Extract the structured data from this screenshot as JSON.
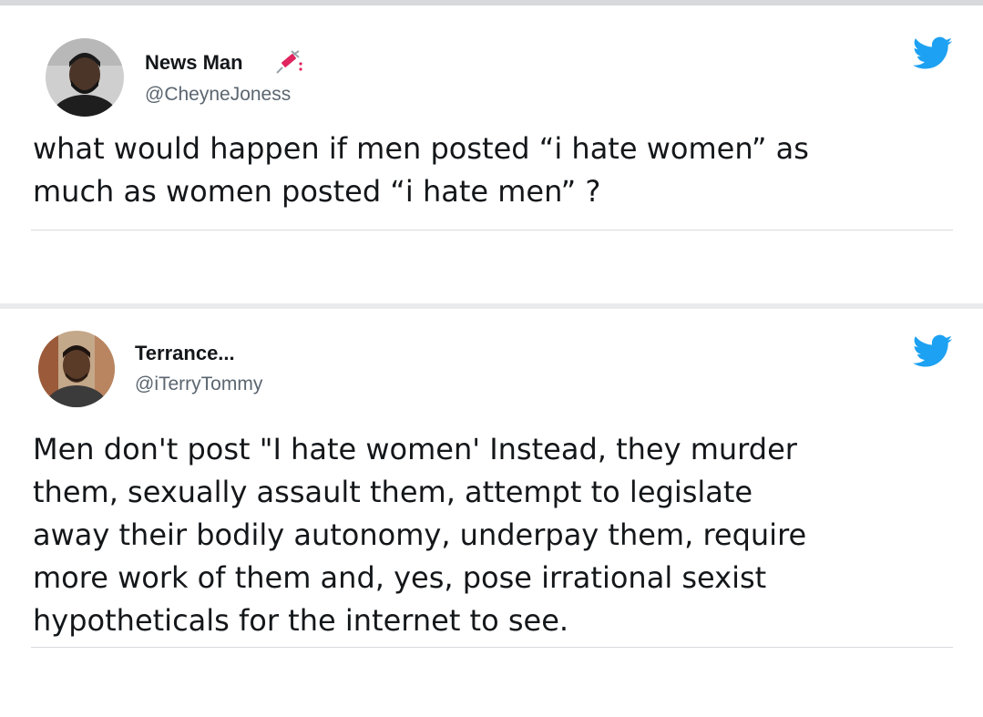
{
  "tweets": [
    {
      "author_name": "News Man",
      "handle": "@CheyneJoness",
      "text": "what would happen if men posted “i hate women” as\nmuch as women posted “i hate men” ?",
      "badge_icon": "syringe-icon",
      "brand_icon": "twitter-bird-icon"
    },
    {
      "author_name": "Terrance...",
      "handle": "@iTerryTommy",
      "text": "Men don't post \"I hate women' Instead, they murder\nthem, sexually assault them, attempt to legislate\naway their bodily autonomy, underpay them, require\nmore work of them and, yes, pose irrational sexist\nhypotheticals for the internet to see.",
      "brand_icon": "twitter-bird-icon"
    }
  ],
  "colors": {
    "twitter_blue": "#1da1f2",
    "text": "#14171a",
    "handle": "#5b6670",
    "background": "#e9eaec"
  }
}
